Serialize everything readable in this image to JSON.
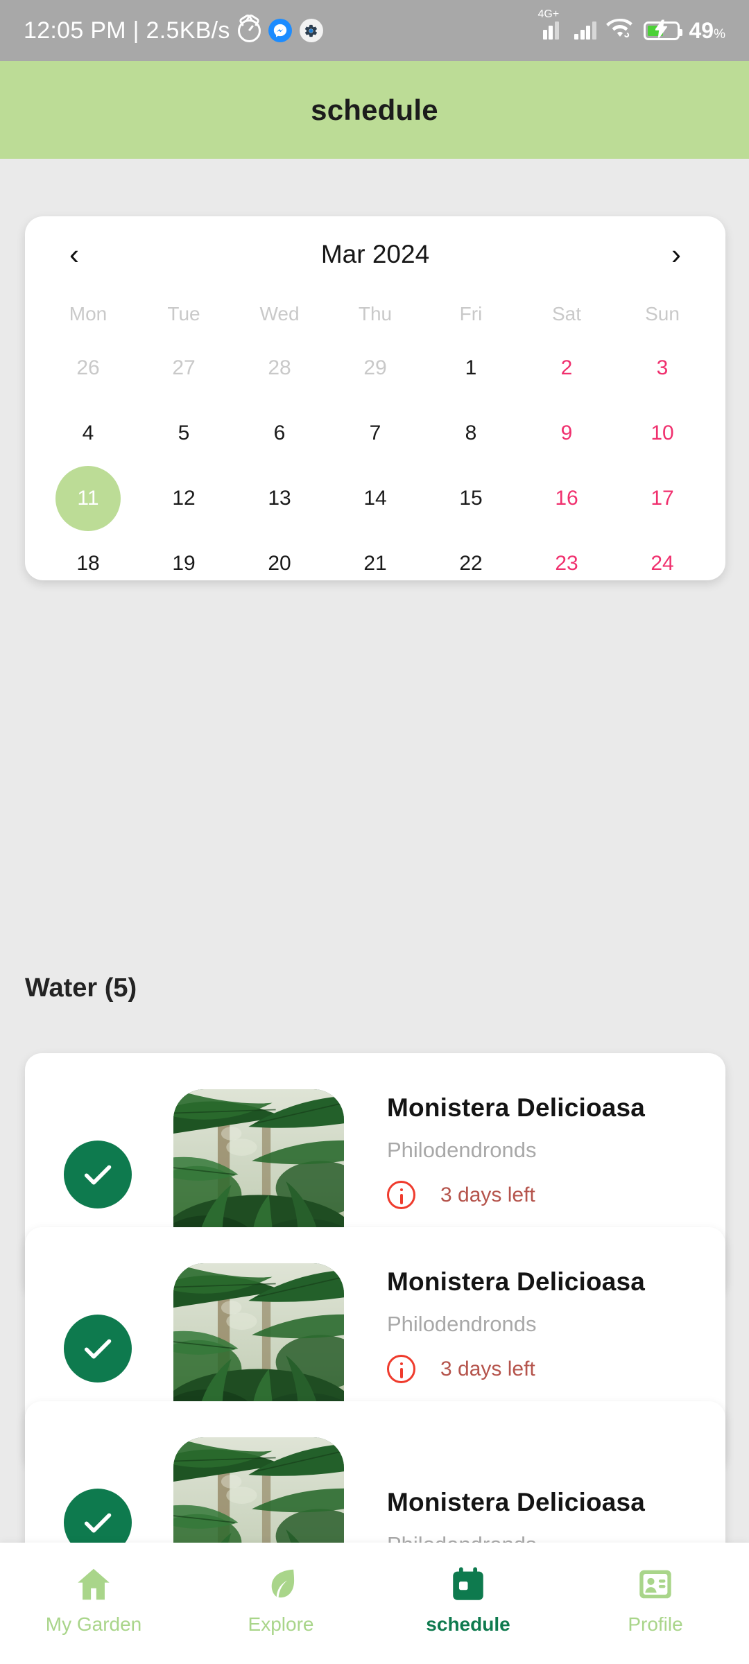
{
  "statusbar": {
    "clock": "12:05 PM | 2.5KB/s",
    "alarm_icon": "alarm-icon",
    "messenger_icon": "messenger-icon",
    "settings_icon": "gear-icon",
    "network_label": "4G+",
    "wifi_icon": "wifi-icon",
    "battery_icon": "battery-charging-icon",
    "battery_percent": "49",
    "battery_percent_unit": "%"
  },
  "header": {
    "title": "schedule"
  },
  "calendar": {
    "prev_label": "‹",
    "next_label": "›",
    "month_label": "Mar 2024",
    "dow": [
      "Mon",
      "Tue",
      "Wed",
      "Thu",
      "Fri",
      "Sat",
      "Sun"
    ],
    "selected_day": "11",
    "weeks": [
      [
        {
          "d": "26",
          "state": "muted"
        },
        {
          "d": "27",
          "state": "muted"
        },
        {
          "d": "28",
          "state": "muted"
        },
        {
          "d": "29",
          "state": "muted"
        },
        {
          "d": "1",
          "state": "normal"
        },
        {
          "d": "2",
          "state": "weekend"
        },
        {
          "d": "3",
          "state": "weekend"
        }
      ],
      [
        {
          "d": "4",
          "state": "normal"
        },
        {
          "d": "5",
          "state": "normal"
        },
        {
          "d": "6",
          "state": "normal"
        },
        {
          "d": "7",
          "state": "normal"
        },
        {
          "d": "8",
          "state": "normal"
        },
        {
          "d": "9",
          "state": "weekend"
        },
        {
          "d": "10",
          "state": "weekend"
        }
      ],
      [
        {
          "d": "11",
          "state": "selected"
        },
        {
          "d": "12",
          "state": "normal"
        },
        {
          "d": "13",
          "state": "normal"
        },
        {
          "d": "14",
          "state": "normal"
        },
        {
          "d": "15",
          "state": "normal"
        },
        {
          "d": "16",
          "state": "weekend"
        },
        {
          "d": "17",
          "state": "weekend"
        }
      ],
      [
        {
          "d": "18",
          "state": "normal"
        },
        {
          "d": "19",
          "state": "normal"
        },
        {
          "d": "20",
          "state": "normal"
        },
        {
          "d": "21",
          "state": "normal"
        },
        {
          "d": "22",
          "state": "normal"
        },
        {
          "d": "23",
          "state": "weekend"
        },
        {
          "d": "24",
          "state": "weekend"
        }
      ]
    ]
  },
  "section": {
    "title": "Water (5)"
  },
  "plants": [
    {
      "name": "Monistera Delicioasa",
      "species": "Philodendronds",
      "info_icon": "info-circle-icon",
      "info_text": "3 days left",
      "water_icon": "water-drop-icon",
      "water_text": "3 days left",
      "check_icon": "check-circle-icon",
      "thumb_icon": "plant-photo"
    },
    {
      "name": "Monistera Delicioasa",
      "species": "Philodendronds",
      "info_icon": "info-circle-icon",
      "info_text": "3 days left",
      "water_icon": "water-drop-icon",
      "water_text": "3 days left",
      "check_icon": "check-circle-icon",
      "thumb_icon": "plant-photo"
    },
    {
      "name": "Monistera Delicioasa",
      "species": "Philodendronds",
      "info_icon": "info-circle-icon",
      "info_text": "",
      "water_icon": "water-drop-icon",
      "water_text": "",
      "check_icon": "check-circle-icon",
      "thumb_icon": "plant-photo"
    }
  ],
  "bottomnav": {
    "items": [
      {
        "label": "My Garden",
        "icon": "house-icon",
        "active": false
      },
      {
        "label": "Explore",
        "icon": "leaf-icon",
        "active": false
      },
      {
        "label": "schedule",
        "icon": "calendar-icon",
        "active": true
      },
      {
        "label": "Profile",
        "icon": "id-card-icon",
        "active": false
      }
    ]
  },
  "colors": {
    "brand_light_green": "#bcdc96",
    "brand_dark_green": "#0e7a4e",
    "nav_inactive_green": "#a9d58a",
    "weekend_pink": "#f0306e",
    "info_red": "#ef3b2d",
    "info_text_red": "#b5544c",
    "water_blue": "#1a62c4",
    "page_bg": "#eaeaea",
    "statusbar_bg": "#a8a8a8"
  }
}
